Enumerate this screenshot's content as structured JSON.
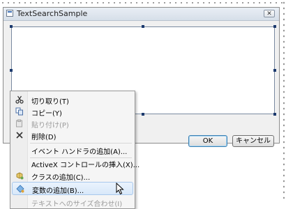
{
  "window": {
    "title": "TextSearchSample",
    "close_glyph": "✕"
  },
  "dialog_buttons": {
    "ok_label": "OK",
    "cancel_label": "キャンセル"
  },
  "context_menu": {
    "items": [
      {
        "label": "切り取り(T)",
        "icon": "scissors-icon",
        "enabled": true
      },
      {
        "label": "コピー(Y)",
        "icon": "copy-icon",
        "enabled": true
      },
      {
        "label": "貼り付け(P)",
        "icon": "paste-icon",
        "enabled": false
      },
      {
        "label": "削除(D)",
        "icon": "delete-icon",
        "enabled": true
      },
      {
        "label": "イベント ハンドラの追加(A)...",
        "icon": "",
        "enabled": true
      },
      {
        "label": "ActiveX コントロールの挿入(X)...",
        "icon": "",
        "enabled": true
      },
      {
        "label": "クラスの追加(C)...",
        "icon": "add-class-icon",
        "enabled": true
      },
      {
        "label": "変数の追加(B)...",
        "icon": "add-variable-icon",
        "enabled": true,
        "highlighted": true
      },
      {
        "label": "テキストへのサイズ合わせ(I)",
        "icon": "",
        "enabled": false
      }
    ]
  },
  "colors": {
    "selection_handle": "#1c3a6e",
    "menu_highlight": "#d8e8f9",
    "disabled_text": "#9a9a9a"
  }
}
